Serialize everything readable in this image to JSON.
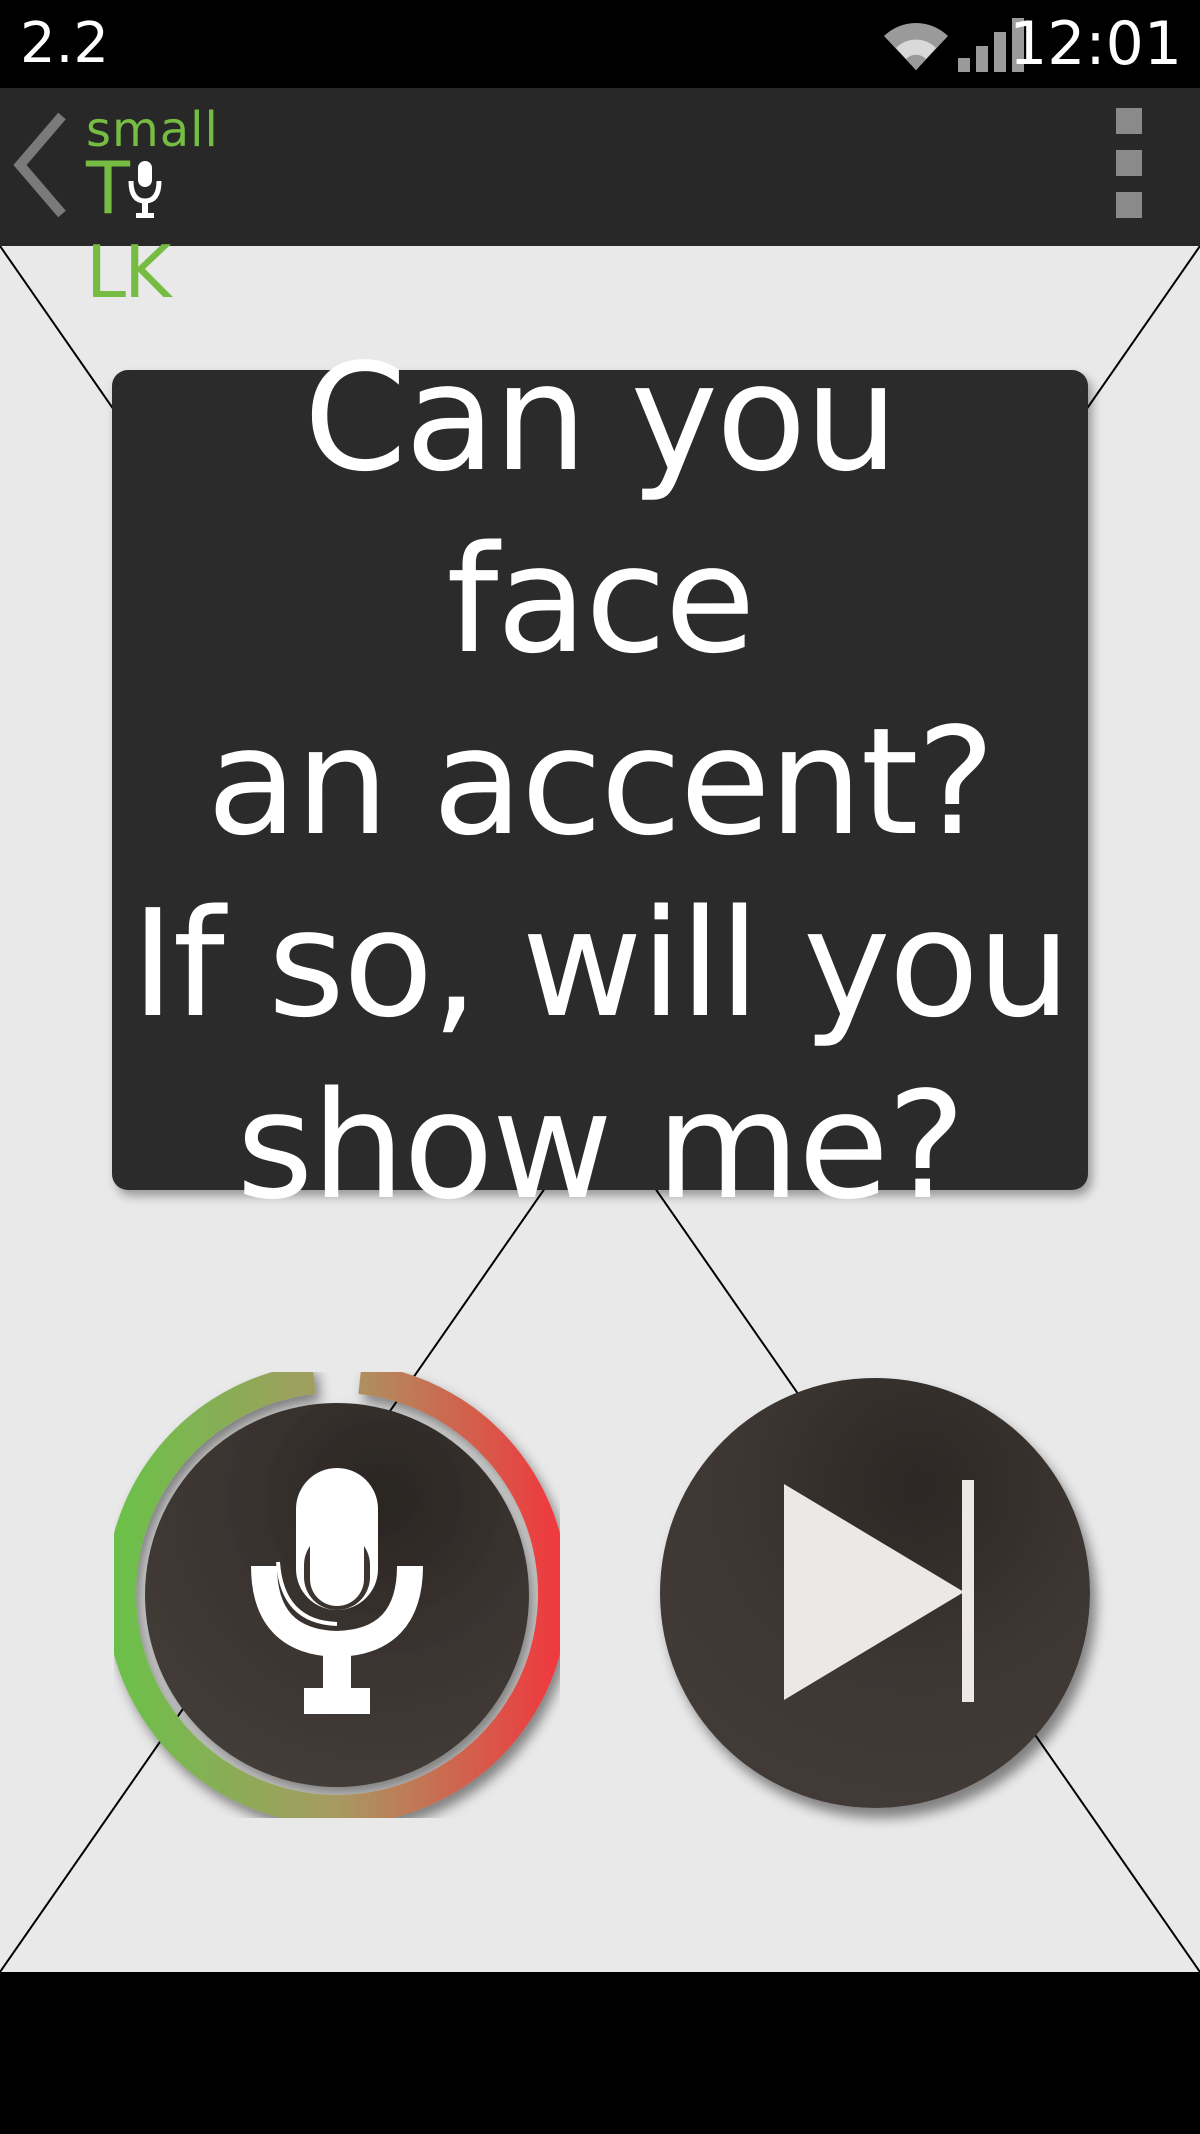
{
  "status_bar": {
    "left_text": "2.2",
    "time": "12:01",
    "wifi_icon": "wifi-icon",
    "signal_icon": "signal-icon"
  },
  "action_bar": {
    "back_icon": "chevron-left-icon",
    "logo_small": "small",
    "logo_talk": "TLK",
    "logo_mic_icon": "microphone-icon",
    "overflow_icon": "overflow-menu-icon",
    "logo_color": "#76bc43"
  },
  "question": {
    "text": "Can you face\nan accent?\nIf so, will you\nshow me?"
  },
  "controls": {
    "record_icon": "microphone-icon",
    "skip_icon": "skip-next-icon",
    "record_ring_start_color": "#6cc04a",
    "record_ring_end_color": "#ee3a3f"
  },
  "colors": {
    "background": "#e9e9e9",
    "card": "#2b2b2b",
    "action_bar": "#282828",
    "accent_green": "#76bc43"
  }
}
